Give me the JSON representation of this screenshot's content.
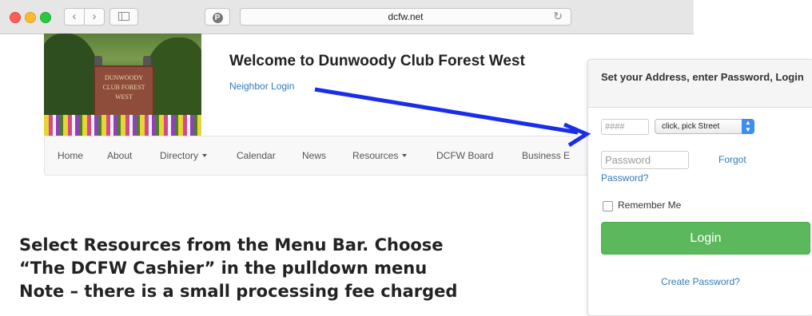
{
  "browser": {
    "url": "dcfw.net",
    "back_glyph": "‹",
    "forward_glyph": "›",
    "reload_glyph": "↻",
    "pinterest_glyph": "P"
  },
  "header": {
    "welcome": "Welcome to Dunwoody Club Forest West",
    "neighbor_login": "Neighbor Login",
    "photo_sign": "DUNWOODY CLUB FOREST WEST"
  },
  "nav": {
    "items": [
      {
        "label": "Home",
        "dropdown": false
      },
      {
        "label": "About",
        "dropdown": false
      },
      {
        "label": "Directory",
        "dropdown": true
      },
      {
        "label": "Calendar",
        "dropdown": false
      },
      {
        "label": "News",
        "dropdown": false
      },
      {
        "label": "Resources",
        "dropdown": true
      },
      {
        "label": "DCFW Board",
        "dropdown": false
      },
      {
        "label": "Business E",
        "dropdown": false
      }
    ]
  },
  "instructions": {
    "line1": "Select Resources from the Menu Bar.  Choose",
    "line2": "“The DCFW Cashier” in the pulldown menu",
    "line3": "Note – there is a small processing fee charged"
  },
  "login_panel": {
    "title": "Set your Address, enter Password, Login",
    "house_number_placeholder": "####",
    "street_select_value": "click, pick Street",
    "password_placeholder": "Password",
    "forgot_label": "Forgot",
    "forgot_label_2": "Password?",
    "remember_label": "Remember Me",
    "login_button": "Login",
    "create_password": "Create Password?"
  },
  "colors": {
    "link": "#337ab7",
    "login_button": "#5cb85c",
    "annotation_arrow": "#1a2ee8"
  }
}
